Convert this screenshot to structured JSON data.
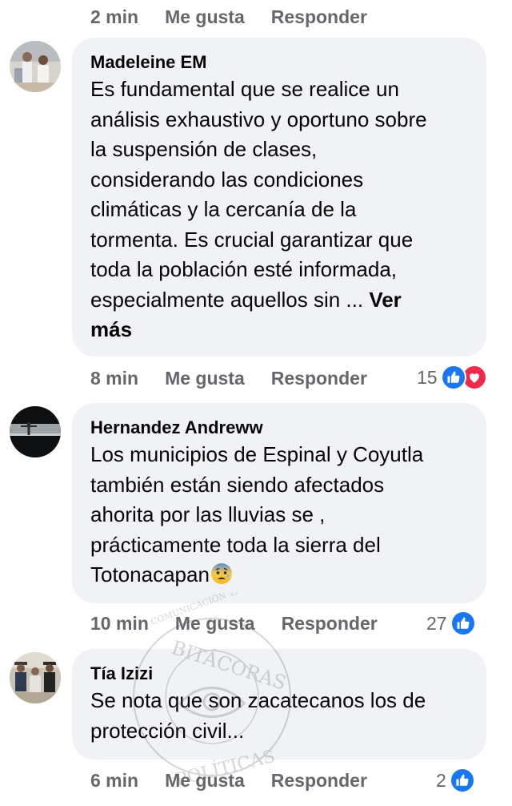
{
  "top_meta": {
    "time": "2 min",
    "like": "Me gusta",
    "reply": "Responder"
  },
  "comments": [
    {
      "author": "Madeleine EM",
      "lines": [
        "Es fundamental que se realice un",
        "análisis exhaustivo y oportuno sobre",
        "la suspensión de clases,",
        "considerando las condiciones",
        "climáticas y la cercanía de la",
        "tormenta. Es crucial garantizar que",
        "toda la población esté informada,",
        "especialmente aquellos sin ... "
      ],
      "see_more_1": "Ver",
      "see_more_2": "más",
      "time": "8 min",
      "like": "Me gusta",
      "reply": "Responder",
      "reaction_count": "15",
      "reactions": [
        "like-icon",
        "love-icon"
      ]
    },
    {
      "author": "Hernandez Andreww",
      "lines": [
        "Los municipios de Espinal y Coyutla",
        "también están siendo afectados",
        "ahorita por las lluvias se ,",
        "prácticamente toda la sierra del",
        "Totonacapan"
      ],
      "emoji": "anxious-face-emoji",
      "time": "10 min",
      "like": "Me gusta",
      "reply": "Responder",
      "reaction_count": "27",
      "reactions": [
        "like-icon"
      ]
    },
    {
      "author": "Tía Izizi",
      "lines": [
        "Se nota que son zacatecanos los de",
        "protección civil..."
      ],
      "time": "6 min",
      "like": "Me gusta",
      "reply": "Responder",
      "reaction_count": "2",
      "reactions": [
        "like-icon"
      ]
    }
  ],
  "watermark": {
    "top_text": "COMUNICACIÓN TRASCENDENTE",
    "main_text": "BITÁCORAS",
    "bottom_text": "POLÍTICAS"
  },
  "colors": {
    "bubble": "#f0f2f5",
    "meta": "#65676b",
    "like": "#1877f2",
    "love": "#f02849"
  }
}
